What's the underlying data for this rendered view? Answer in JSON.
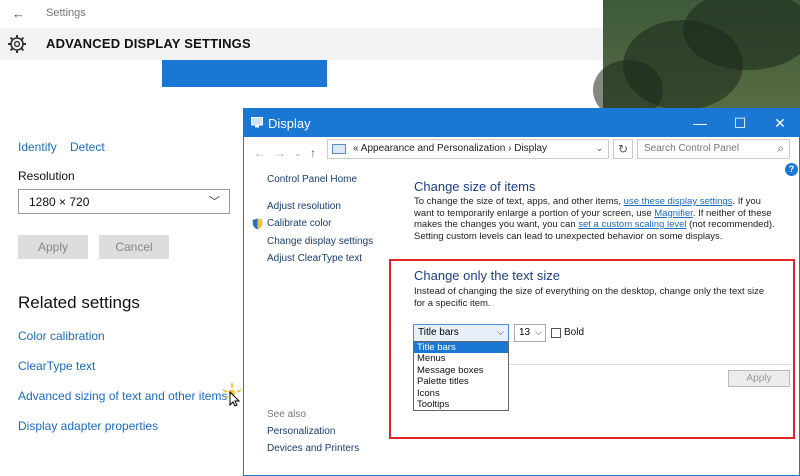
{
  "settings": {
    "back_glyph": "←",
    "app_title": "Settings",
    "page_title": "ADVANCED DISPLAY SETTINGS",
    "identify": "Identify",
    "detect": "Detect",
    "resolution_label": "Resolution",
    "resolution_value": "1280 × 720",
    "apply": "Apply",
    "cancel": "Cancel",
    "related_heading": "Related settings",
    "links": [
      "Color calibration",
      "ClearType text",
      "Advanced sizing of text and other items",
      "Display adapter properties"
    ]
  },
  "display": {
    "title": "Display",
    "controls": {
      "minimize": "—",
      "maximize": "☐",
      "close": "✕"
    },
    "breadcrumb": "«  Appearance and Personalization  ›  Display",
    "search_placeholder": "Search Control Panel",
    "sidebar": {
      "home": "Control Panel Home",
      "items": [
        "Adjust resolution",
        "Calibrate color",
        "Change display settings",
        "Adjust ClearType text"
      ],
      "see_also": "See also",
      "see_also_items": [
        "Personalization",
        "Devices and Printers"
      ]
    },
    "size_heading": "Change size of items",
    "size_text": {
      "p1": "To change the size of text, apps, and other items, ",
      "link1": "use these display settings",
      "p2": ".  If you want to temporarily enlarge a portion of your screen, use ",
      "link2": "Magnifier",
      "p3": ".  If neither of these makes the changes you want, you can ",
      "link3": "set a custom scaling level",
      "p4": " (not recommended).  Setting custom levels can lead to unexpected behavior on some displays."
    },
    "text_heading": "Change only the text size",
    "text_desc": "Instead of changing the size of everything on the desktop, change only the text size for a specific item.",
    "item_selected": "Title bars",
    "item_options": [
      "Title bars",
      "Menus",
      "Message boxes",
      "Palette titles",
      "Icons",
      "Tooltips"
    ],
    "size_value": "13",
    "bold_label": "Bold",
    "apply": "Apply"
  },
  "colors": {
    "accent": "#1a78d4",
    "highlight_box": "#e0262b",
    "link": "#1a6cbf"
  }
}
